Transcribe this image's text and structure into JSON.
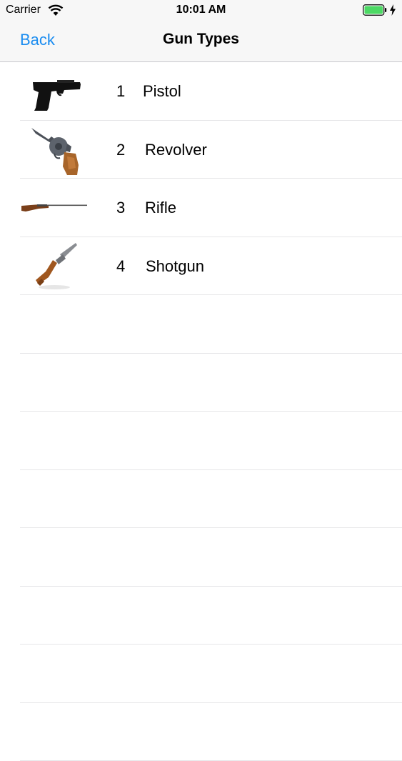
{
  "status_bar": {
    "carrier": "Carrier",
    "time": "10:01 AM",
    "battery_color": "#4cd964"
  },
  "nav": {
    "back_label": "Back",
    "title": "Gun Types",
    "tint_color": "#1a8cf0"
  },
  "rows": [
    {
      "number": "1",
      "label": "Pistol",
      "icon": "pistol-icon"
    },
    {
      "number": "2",
      "label": "Revolver",
      "icon": "revolver-icon"
    },
    {
      "number": "3",
      "label": "Rifle",
      "icon": "rifle-icon"
    },
    {
      "number": "4",
      "label": "Shotgun",
      "icon": "shotgun-icon"
    }
  ]
}
